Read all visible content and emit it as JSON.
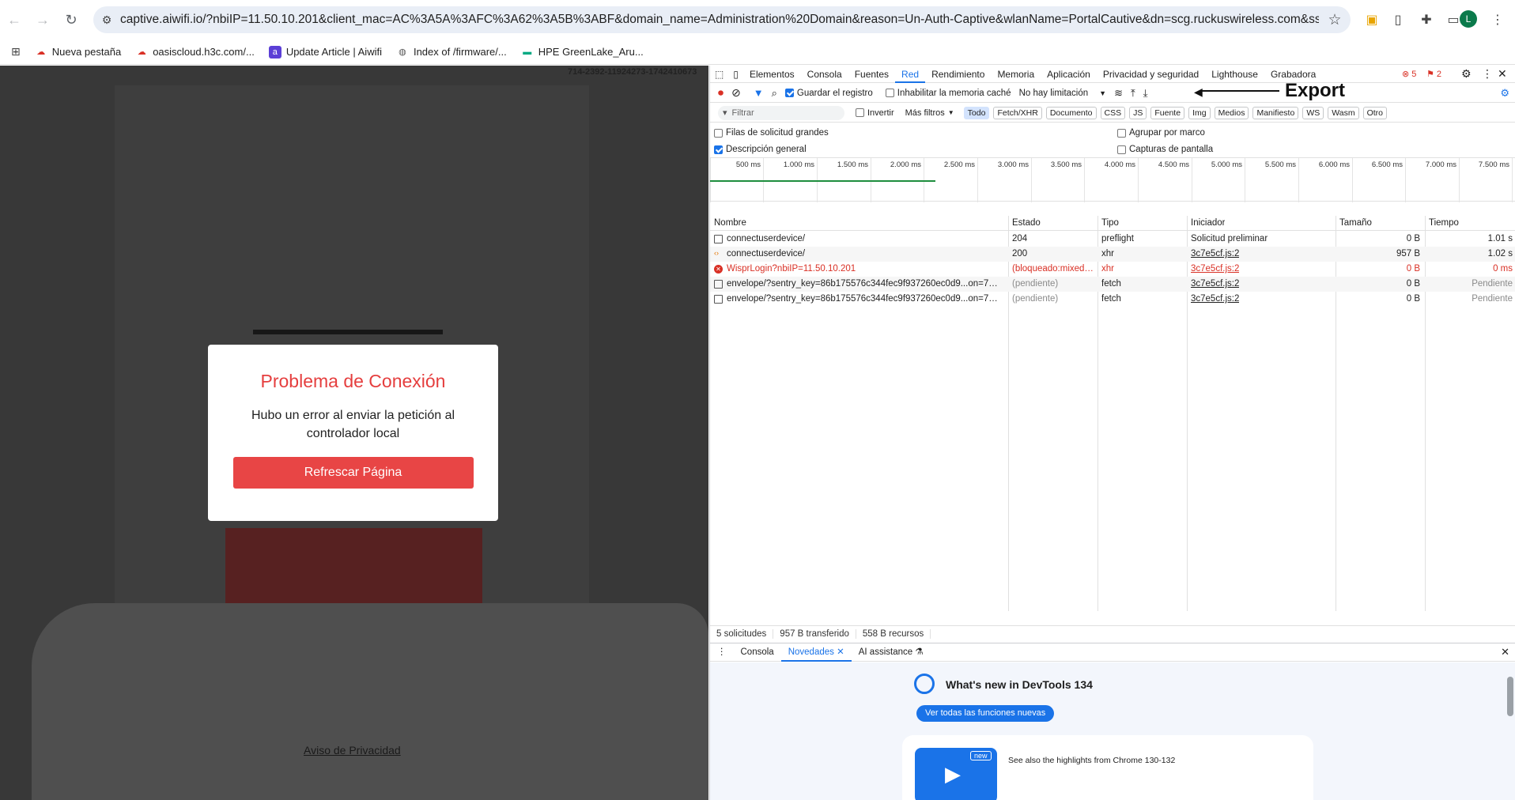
{
  "browser": {
    "url": "captive.aiwifi.io/?nbiIP=11.50.10.201&client_mac=AC%3A5A%3AFC%3A62%3A5B%3ABF&domain_name=Administration%20Domain&reason=Un-Auth-Captive&wlanName=PortalCautive&dn=scg.ruckuswireless.com&ssid=Ruckus_Hotspot&...",
    "profile_initial": "L",
    "ext_badge": "1"
  },
  "bookmarks": [
    {
      "label": "Nueva pestaña",
      "icon": "cloud-icon"
    },
    {
      "label": "oasiscloud.h3c.com/...",
      "icon": "cloud-icon"
    },
    {
      "label": "Update Article | Aiwifi",
      "icon": "aiwifi-icon"
    },
    {
      "label": "Index of /firmware/...",
      "icon": "globe-icon"
    },
    {
      "label": "HPE GreenLake_Aru...",
      "icon": "hpe-icon"
    }
  ],
  "page": {
    "id_text": "714-2392-11924273-1742410673",
    "modal_title": "Problema de Conexión",
    "modal_text": "Hubo un error al enviar la petición al controlador local",
    "refresh_label": "Refrescar Página",
    "privacy_link": "Aviso de Privacidad"
  },
  "devtools": {
    "tabs": [
      "Elementos",
      "Consola",
      "Fuentes",
      "Red",
      "Rendimiento",
      "Memoria",
      "Aplicación",
      "Privacidad y seguridad",
      "Lighthouse",
      "Grabadora"
    ],
    "active_tab": "Red",
    "error_count": "5",
    "warn_count": "2",
    "toolbar": {
      "preserve_log": "Guardar el registro",
      "disable_cache": "Inhabilitar la memoria caché",
      "throttling": "No hay limitación",
      "export_annotation": "Export"
    },
    "filter": {
      "placeholder": "Filtrar",
      "invert": "Invertir",
      "more_filters": "Más filtros",
      "chips": [
        "Todo",
        "Fetch/XHR",
        "Documento",
        "CSS",
        "JS",
        "Fuente",
        "Img",
        "Medios",
        "Manifiesto",
        "WS",
        "Wasm",
        "Otro"
      ],
      "active_chip": "Todo"
    },
    "options": {
      "large_rows": "Filas de solicitud grandes",
      "overview": "Descripción general",
      "group_by_frame": "Agrupar por marco",
      "screenshots": "Capturas de pantalla"
    },
    "timeline_ticks": [
      "500 ms",
      "1.000 ms",
      "1.500 ms",
      "2.000 ms",
      "2.500 ms",
      "3.000 ms",
      "3.500 ms",
      "4.000 ms",
      "4.500 ms",
      "5.000 ms",
      "5.500 ms",
      "6.000 ms",
      "6.500 ms",
      "7.000 ms",
      "7.500 ms"
    ],
    "columns": [
      "Nombre",
      "Estado",
      "Tipo",
      "Iniciador",
      "Tamaño",
      "Tiempo"
    ],
    "rows": [
      {
        "name": "connectuserdevice/",
        "status": "204",
        "type": "preflight",
        "initiator": "Solicitud preliminar",
        "size": "0 B",
        "time": "1.01 s",
        "kind": "doc"
      },
      {
        "name": "connectuserdevice/",
        "status": "200",
        "type": "xhr",
        "initiator": "3c7e5cf.js:2",
        "size": "957 B",
        "time": "1.02 s",
        "kind": "xhr"
      },
      {
        "name": "WisprLogin?nbiIP=11.50.10.201",
        "status": "(bloqueado:mixed-c...",
        "type": "xhr",
        "initiator": "3c7e5cf.js:2",
        "size": "0 B",
        "time": "0 ms",
        "kind": "error"
      },
      {
        "name": "envelope/?sentry_key=86b175576c344fec9f937260ec0d9...on=7&sentry...",
        "status": "(pendiente)",
        "type": "fetch",
        "initiator": "3c7e5cf.js:2",
        "size": "0 B",
        "time": "Pendiente",
        "kind": "doc"
      },
      {
        "name": "envelope/?sentry_key=86b175576c344fec9f937260ec0d9...on=7&sentry...",
        "status": "(pendiente)",
        "type": "fetch",
        "initiator": "3c7e5cf.js:2",
        "size": "0 B",
        "time": "Pendiente",
        "kind": "doc"
      }
    ],
    "status": {
      "requests": "5 solicitudes",
      "transferred": "957 B transferido",
      "resources": "558 B recursos"
    },
    "drawer": {
      "tabs": [
        "Consola",
        "Novedades",
        "AI assistance"
      ],
      "active": "Novedades",
      "heading": "What's new in DevTools 134",
      "button": "Ver todas las funciones nuevas",
      "card_badge": "new",
      "card_text": "See also the highlights from Chrome 130-132"
    }
  }
}
